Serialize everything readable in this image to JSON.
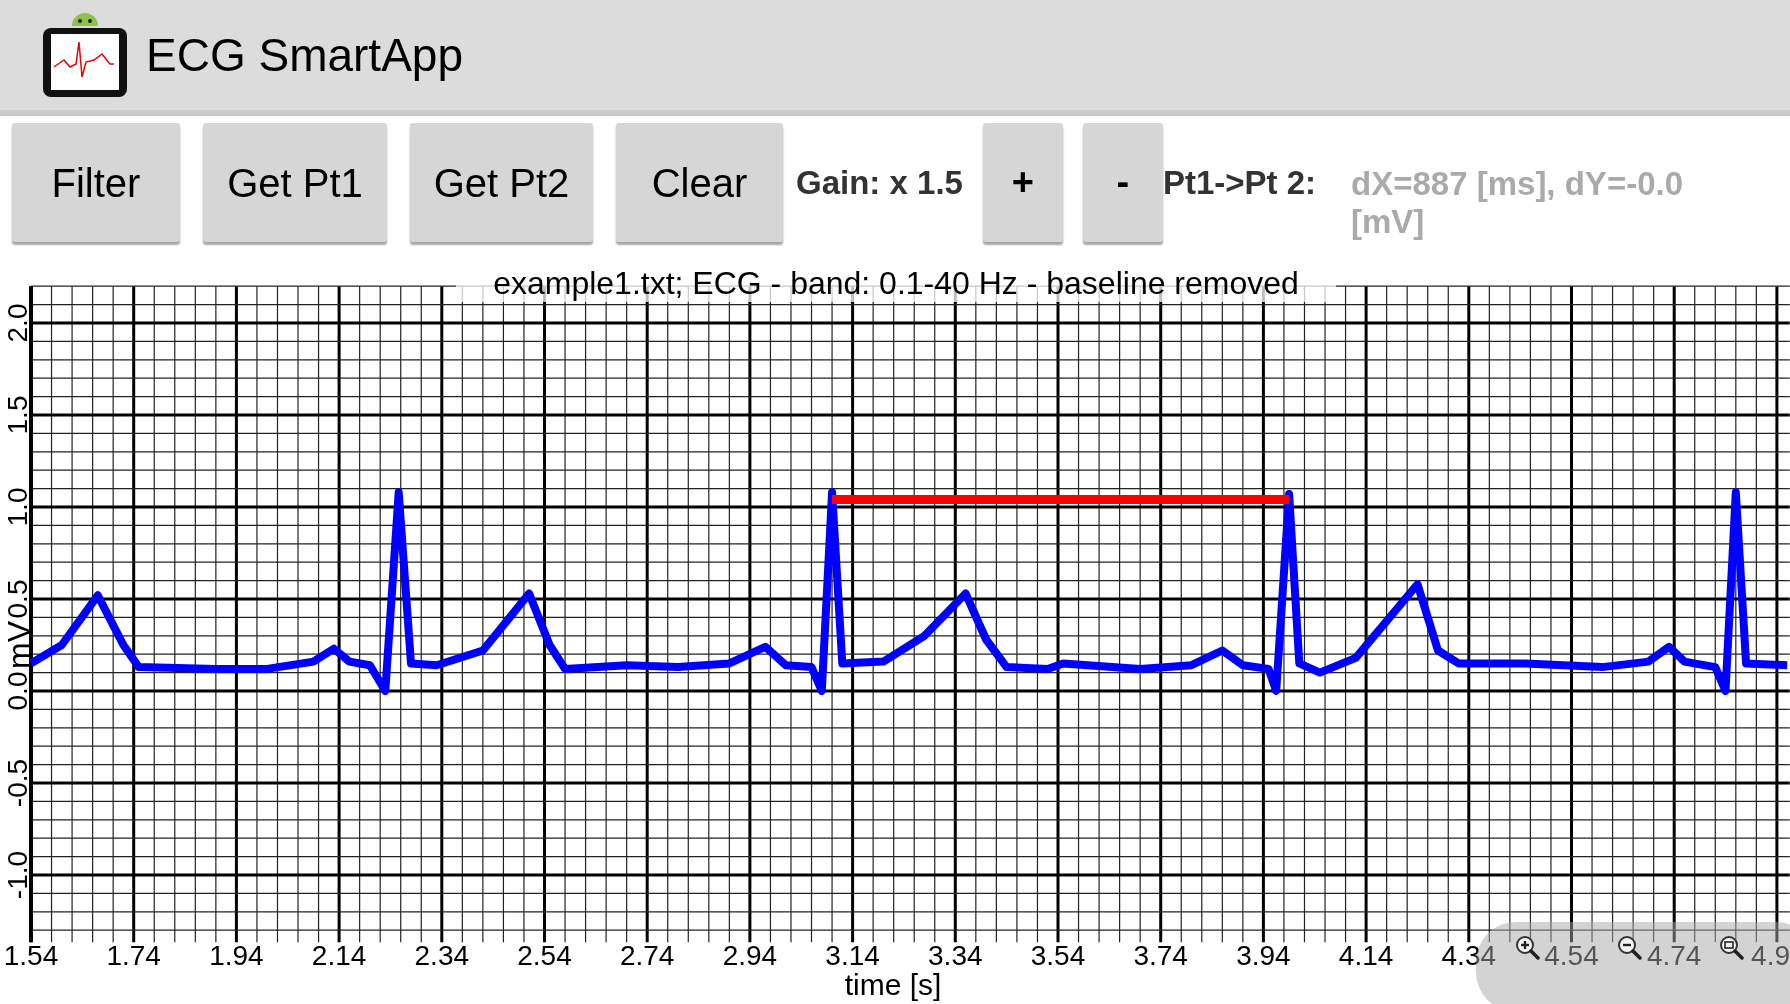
{
  "app_bar": {
    "title": "ECG SmartApp"
  },
  "toolbar": [
    {
      "kind": "button",
      "label": "Filter"
    },
    {
      "kind": "button",
      "label": "Get Pt1"
    },
    {
      "kind": "button",
      "label": "Get Pt2"
    },
    {
      "kind": "button",
      "label": "Clear"
    },
    {
      "kind": "label",
      "label": "Gain: x 1.5"
    },
    {
      "kind": "small_button",
      "label": "+"
    },
    {
      "kind": "small_button",
      "label": "-"
    },
    {
      "kind": "label",
      "label": "Pt1->Pt 2:"
    },
    {
      "kind": "readout",
      "label": "dX=887 [ms], dY=-0.0 [mV]"
    }
  ],
  "chart": {
    "chart_data": {
      "type": "line",
      "title": "example1.txt;  ECG - band: 0.1-40 Hz - baseline removed",
      "xlabel": "time [s]",
      "ylabel": "mV",
      "xlim": [
        1.54,
        4.965
      ],
      "ylim": [
        -1.3,
        2.2
      ],
      "grid": true,
      "xticks": [
        1.54,
        1.74,
        1.94,
        2.14,
        2.34,
        2.54,
        2.74,
        2.94,
        3.14,
        3.34,
        3.54,
        3.74,
        3.94,
        4.14,
        4.34,
        4.54,
        4.74,
        {
          "value": 4.94,
          "label": "4.9"
        }
      ],
      "yticks": [
        {
          "value": -1,
          "label": "-1.0"
        },
        {
          "value": -0.5,
          "label": "-0.5"
        },
        {
          "value": 0,
          "label": "0.0"
        },
        {
          "value": 0.5,
          "label": "0.5"
        },
        {
          "value": 1,
          "label": "1.0"
        },
        {
          "value": 1.5,
          "label": "1.5"
        },
        {
          "value": 2,
          "label": "2.0"
        }
      ],
      "x": [
        1.54,
        1.6,
        1.67,
        1.72,
        1.75,
        1.9,
        2.0,
        2.09,
        2.13,
        2.16,
        2.2,
        2.23,
        2.256,
        2.28,
        2.33,
        2.42,
        2.51,
        2.55,
        2.58,
        2.7,
        2.8,
        2.9,
        2.97,
        3.01,
        3.06,
        3.08,
        3.1,
        3.12,
        3.2,
        3.28,
        3.36,
        3.4,
        3.44,
        3.52,
        3.55,
        3.7,
        3.8,
        3.86,
        3.9,
        3.95,
        3.965,
        3.99,
        4.01,
        4.05,
        4.12,
        4.24,
        4.28,
        4.32,
        4.45,
        4.6,
        4.69,
        4.73,
        4.76,
        4.82,
        4.84,
        4.86,
        4.88,
        4.96
      ],
      "series": [
        {
          "color": "#0000ff",
          "values": [
            0.15,
            0.25,
            0.52,
            0.25,
            0.13,
            0.12,
            0.12,
            0.16,
            0.23,
            0.16,
            0.14,
            0.0,
            1.08,
            0.15,
            0.14,
            0.22,
            0.53,
            0.25,
            0.12,
            0.14,
            0.13,
            0.15,
            0.24,
            0.14,
            0.13,
            0.0,
            1.08,
            0.15,
            0.16,
            0.3,
            0.53,
            0.28,
            0.13,
            0.12,
            0.15,
            0.12,
            0.14,
            0.22,
            0.14,
            0.12,
            0.0,
            1.07,
            0.15,
            0.1,
            0.18,
            0.58,
            0.22,
            0.15,
            0.15,
            0.13,
            0.16,
            0.24,
            0.16,
            0.13,
            0.0,
            1.08,
            0.15,
            0.14
          ]
        },
        {
          "color": "#ff0000",
          "values": [
            null,
            null,
            null,
            null,
            null,
            null,
            null,
            null,
            null,
            null,
            null,
            null,
            null,
            null,
            null,
            null,
            null,
            null,
            null,
            null,
            null,
            null,
            null,
            null,
            null,
            null,
            1.04,
            1.04,
            1.04,
            1.04,
            1.04,
            1.04,
            1.04,
            1.04,
            1.04,
            1.04,
            1.04,
            1.04,
            1.04,
            1.04,
            1.04,
            1.04,
            null,
            null,
            null,
            null,
            null,
            null,
            null,
            null,
            null,
            null,
            null,
            null,
            null,
            null,
            null,
            null
          ]
        }
      ]
    },
    "zoom_controls": [
      {
        "kind": "zoom_in"
      },
      {
        "kind": "zoom_out"
      },
      {
        "kind": "reset"
      }
    ]
  }
}
